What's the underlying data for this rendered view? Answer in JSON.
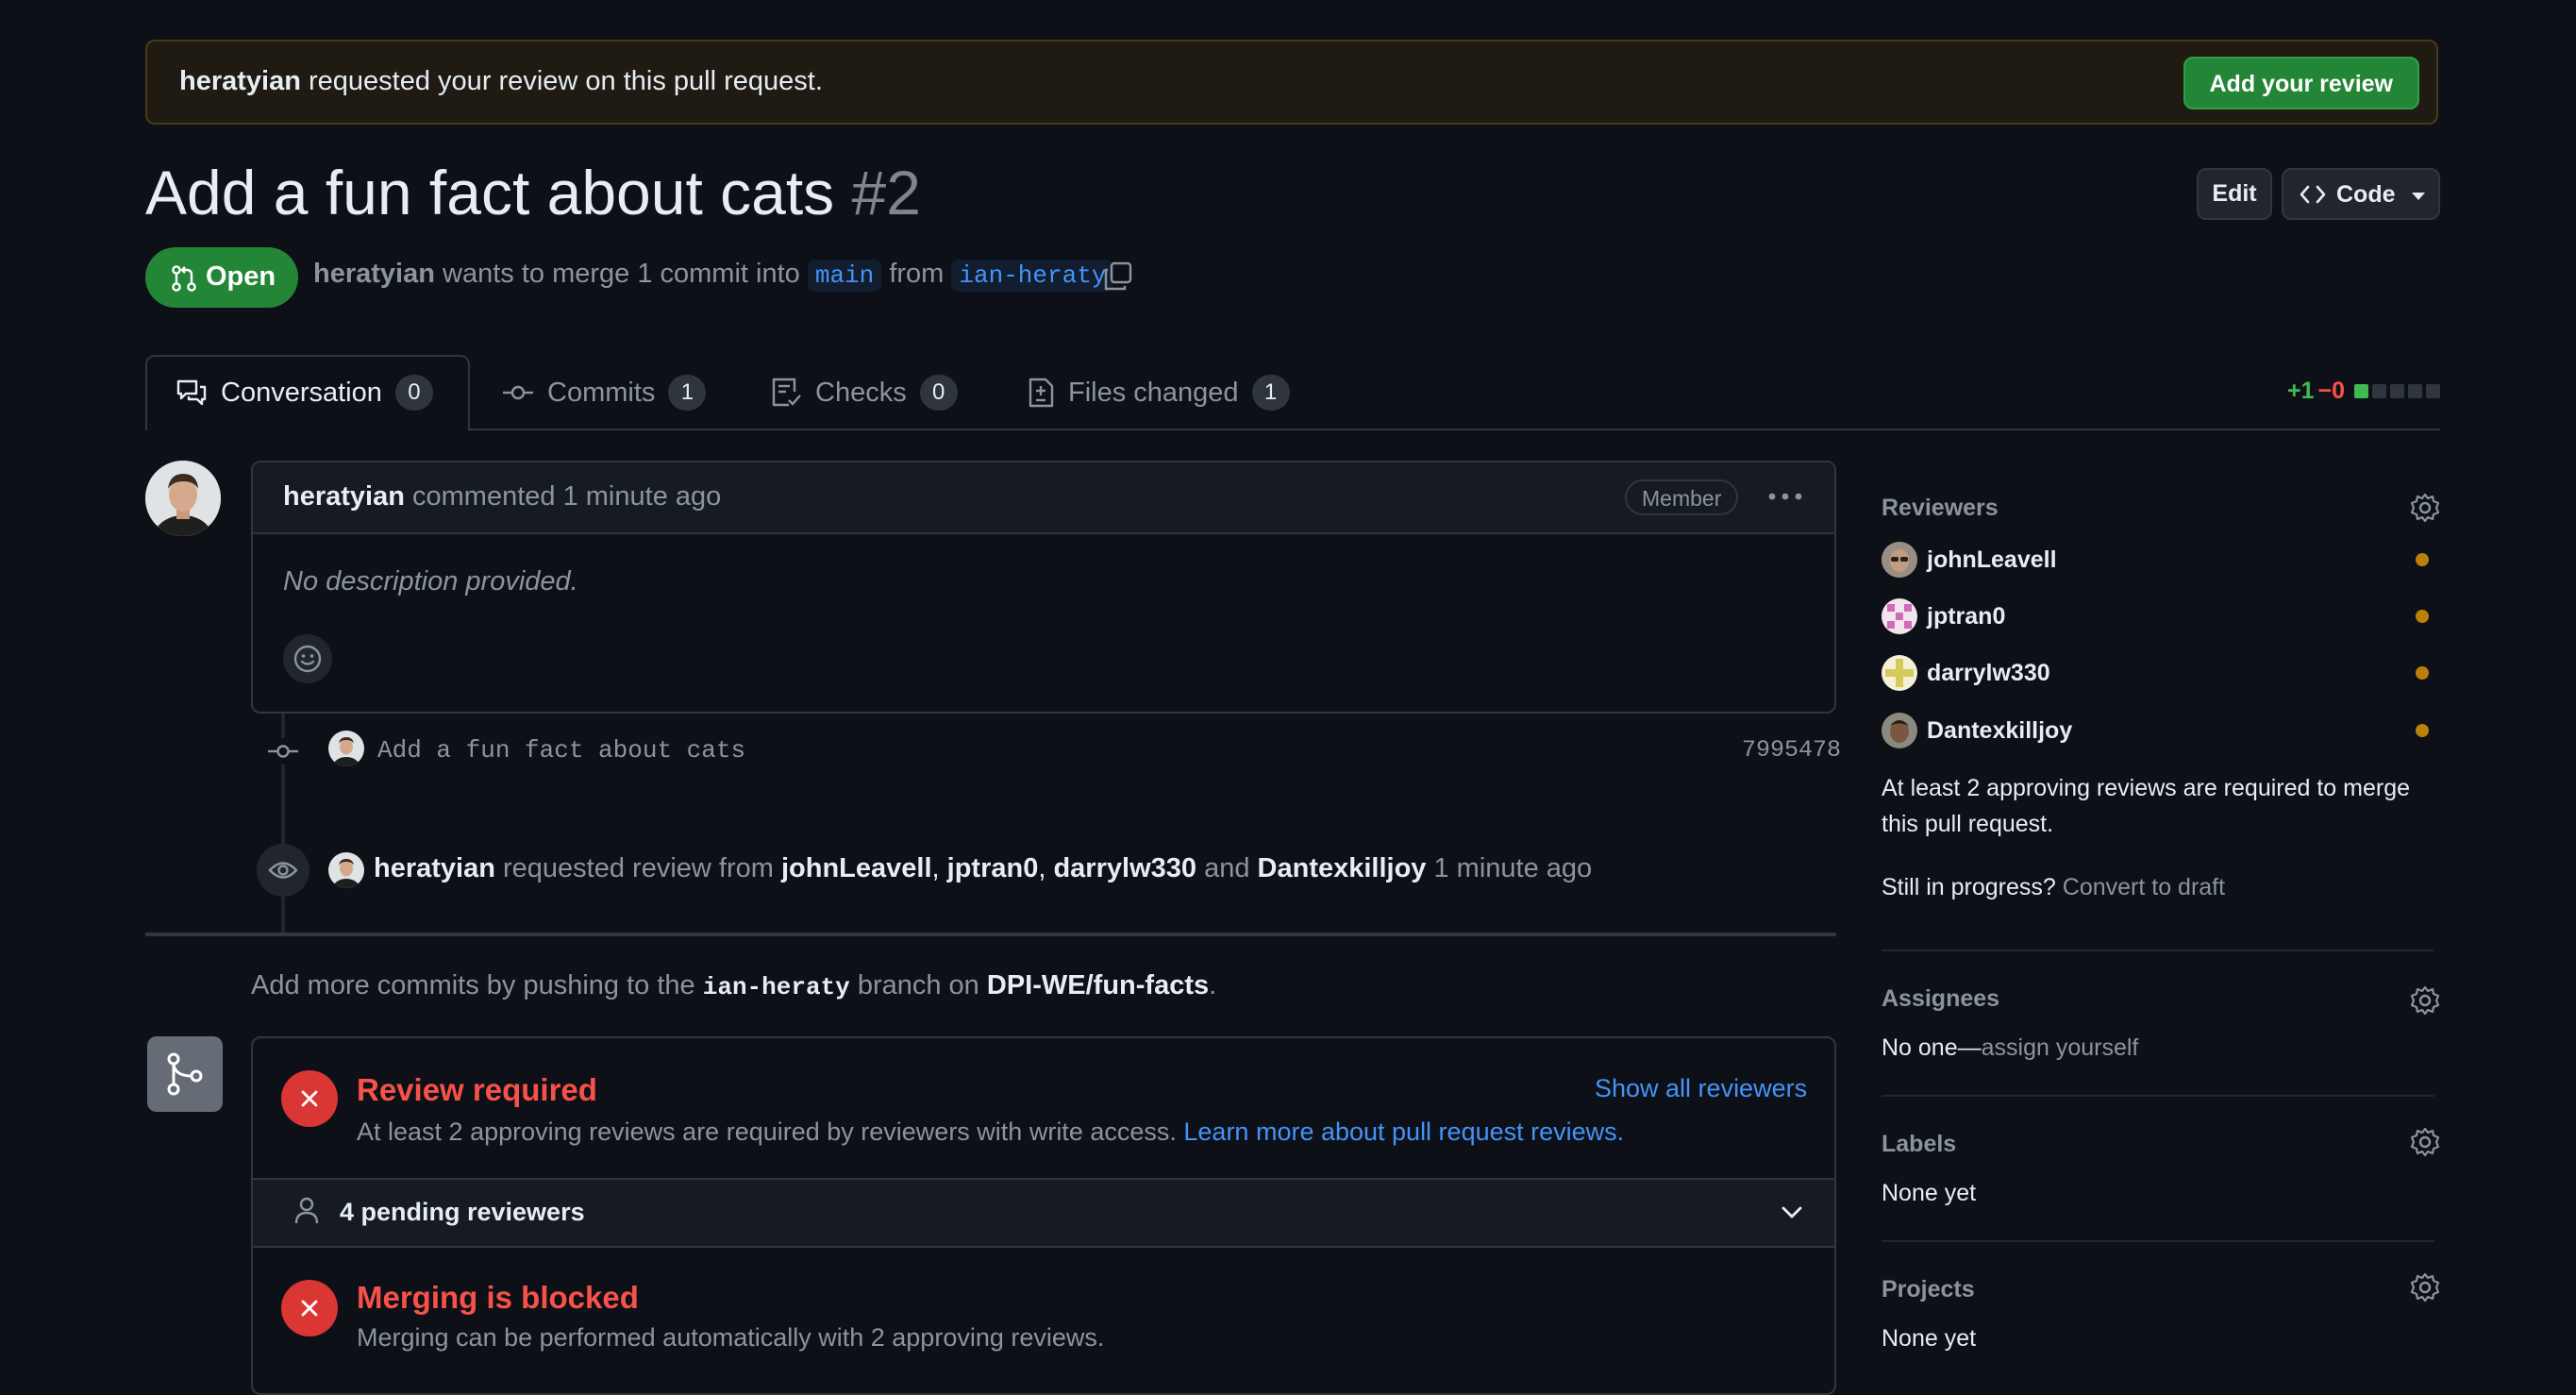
{
  "banner": {
    "user": "heratyian",
    "message": "requested your review on this pull request.",
    "button": "Add your review"
  },
  "header": {
    "title": "Add a fun fact about cats",
    "number": "#2",
    "edit_label": "Edit",
    "code_label": "Code",
    "status": "Open",
    "author": "heratyian",
    "merge_text": "wants to merge 1 commit into",
    "base_branch": "main",
    "from_text": "from",
    "head_branch": "ian-heraty"
  },
  "tabs": [
    {
      "label": "Conversation",
      "count": "0",
      "icon": "comment-discussion-icon"
    },
    {
      "label": "Commits",
      "count": "1",
      "icon": "git-commit-icon"
    },
    {
      "label": "Checks",
      "count": "0",
      "icon": "checklist-icon"
    },
    {
      "label": "Files changed",
      "count": "1",
      "icon": "file-diff-icon"
    }
  ],
  "diffstat": {
    "additions": "+1",
    "deletions": "−0"
  },
  "comment": {
    "author": "heratyian",
    "action": "commented",
    "time": "1 minute ago",
    "badge": "Member",
    "body": "No description provided."
  },
  "commit": {
    "message": "Add a fun fact about cats",
    "sha": "7995478"
  },
  "review_request": {
    "author": "heratyian",
    "text": "requested review from",
    "reviewers": [
      "johnLeavell",
      "jptran0",
      "darrylw330",
      "Dantexkilljoy"
    ],
    "sep1": ",",
    "sep2": ",",
    "and": "and",
    "time": "1 minute ago"
  },
  "push_hint": {
    "before": "Add more commits by pushing to the",
    "branch": "ian-heraty",
    "middle": "branch on",
    "repo": "DPI-WE/fun-facts",
    "end": "."
  },
  "merge_box": {
    "review_title": "Review required",
    "review_desc": "At least 2 approving reviews are required by reviewers with write access.",
    "review_link": "Learn more about pull request reviews.",
    "show_all": "Show all reviewers",
    "pending": "4 pending reviewers",
    "blocked_title": "Merging is blocked",
    "blocked_desc": "Merging can be performed automatically with 2 approving reviews."
  },
  "sidebar": {
    "reviewers_title": "Reviewers",
    "reviewers": [
      "johnLeavell",
      "jptran0",
      "darrylw330",
      "Dantexkilljoy"
    ],
    "approval_note": "At least 2 approving reviews are required to merge this pull request.",
    "progress_q": "Still in progress?",
    "convert": "Convert to draft",
    "assignees_title": "Assignees",
    "assignees_none": "No one—",
    "assign_self": "assign yourself",
    "labels_title": "Labels",
    "labels_value": "None yet",
    "projects_title": "Projects",
    "projects_value": "None yet"
  },
  "colors": {
    "background": "#0d1117",
    "open_green": "#238636",
    "link_blue": "#4493f8",
    "danger_red": "#da3633",
    "pending_dot": "#bb8009"
  }
}
